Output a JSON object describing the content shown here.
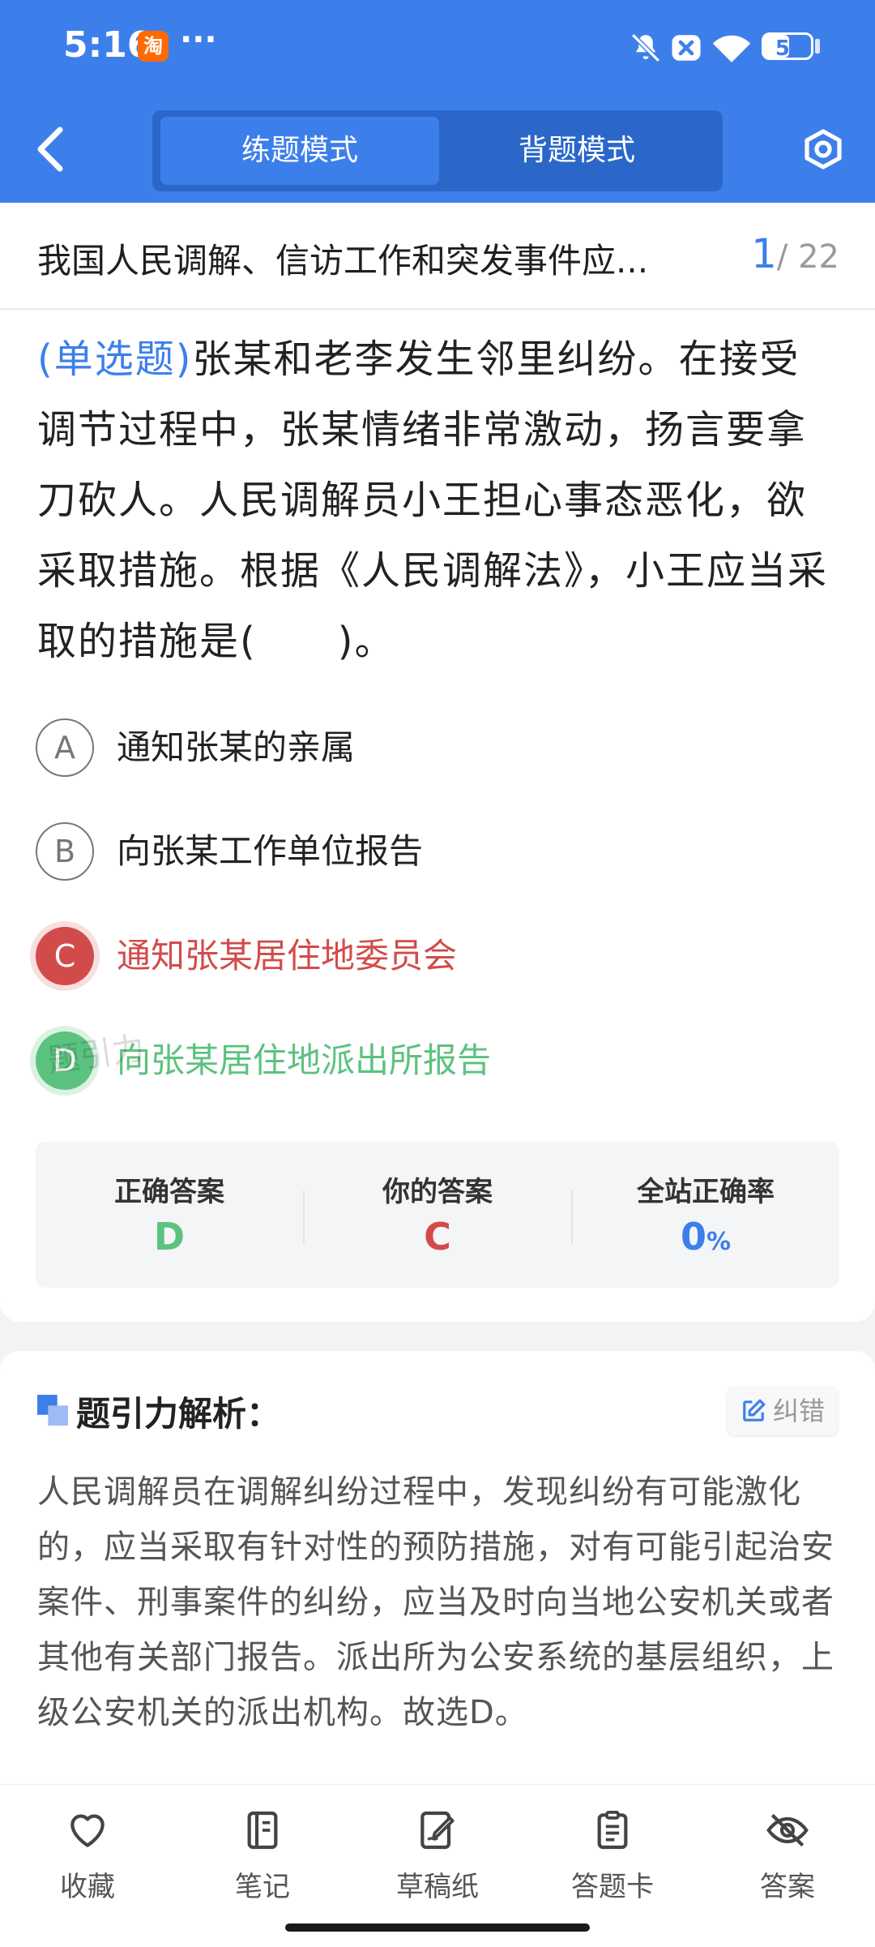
{
  "status_bar": {
    "time": "5:16",
    "app_badge": "淘",
    "more": "···",
    "battery": "53",
    "battery_level": 0.53
  },
  "header": {
    "tabs": [
      {
        "label": "练题模式",
        "active": true
      },
      {
        "label": "背题模式",
        "active": false
      }
    ]
  },
  "question_set": {
    "title": "我国人民调解、信访工作和突发事件应...",
    "current": "1",
    "total": "/ 22"
  },
  "question": {
    "type": "(单选题)",
    "text": "张某和老李发生邻里纠纷。在接受调节过程中，张某情绪非常激动，扬言要拿刀砍人。人民调解员小王担心事态恶化，欲采取措施。根据《人民调解法》，小王应当采取的措施是(　　)。"
  },
  "options": [
    {
      "letter": "A",
      "text": "通知张某的亲属",
      "state": "normal"
    },
    {
      "letter": "B",
      "text": "向张某工作单位报告",
      "state": "normal"
    },
    {
      "letter": "C",
      "text": "通知张某居住地委员会",
      "state": "wrong"
    },
    {
      "letter": "D",
      "text": "向张某居住地派出所报告",
      "state": "right"
    }
  ],
  "watermark": "题引力",
  "answer_summary": {
    "correct_label": "正确答案",
    "correct_value": "D",
    "yours_label": "你的答案",
    "yours_value": "C",
    "rate_label": "全站正确率",
    "rate_value": "0",
    "rate_unit": "%"
  },
  "analysis": {
    "title": "题引力解析：",
    "report_label": "纠错",
    "text": "人民调解员在调解纠纷过程中，发现纠纷有可能激化的，应当采取有针对性的预防措施，对有可能引起治安案件、刑事案件的纠纷，应当及时向当地公安机关或者其他有关部门报告。派出所为公安系统的基层组织，上级公安机关的派出机构。故选D。"
  },
  "bottom_nav": {
    "items": [
      {
        "label": "收藏",
        "icon": "heart-icon"
      },
      {
        "label": "笔记",
        "icon": "notebook-icon"
      },
      {
        "label": "草稿纸",
        "icon": "draft-pen-icon"
      },
      {
        "label": "答题卡",
        "icon": "clipboard-icon"
      },
      {
        "label": "答案",
        "icon": "eye-off-icon"
      }
    ]
  },
  "colors": {
    "primary": "#3d7fea",
    "wrong": "#d24b4b",
    "right": "#5cc27f"
  }
}
